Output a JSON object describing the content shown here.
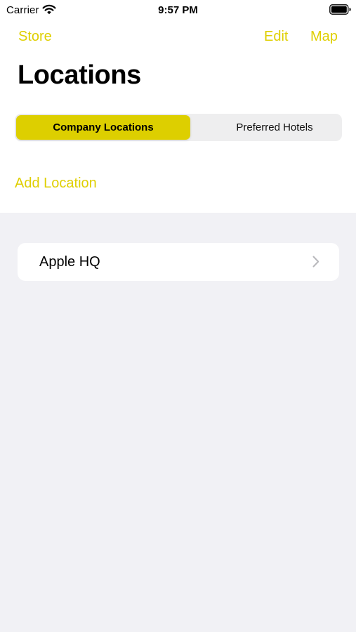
{
  "status_bar": {
    "carrier": "Carrier",
    "time": "9:57 PM",
    "icons": [
      "wifi-icon",
      "battery-icon"
    ]
  },
  "nav": {
    "left_button": "Store",
    "edit_button": "Edit",
    "map_button": "Map"
  },
  "page": {
    "title": "Locations"
  },
  "segmented_control": {
    "segments": [
      {
        "label": "Company Locations",
        "selected": true
      },
      {
        "label": "Preferred Hotels",
        "selected": false
      }
    ]
  },
  "add_location_label": "Add Location",
  "locations": [
    {
      "name": "Apple HQ",
      "icon": "chevron-right-icon"
    }
  ],
  "colors": {
    "accent": "#DFCF00",
    "selected_segment": "#DDCF00",
    "background": "#F1F1F5",
    "surface": "#FFFFFF"
  }
}
